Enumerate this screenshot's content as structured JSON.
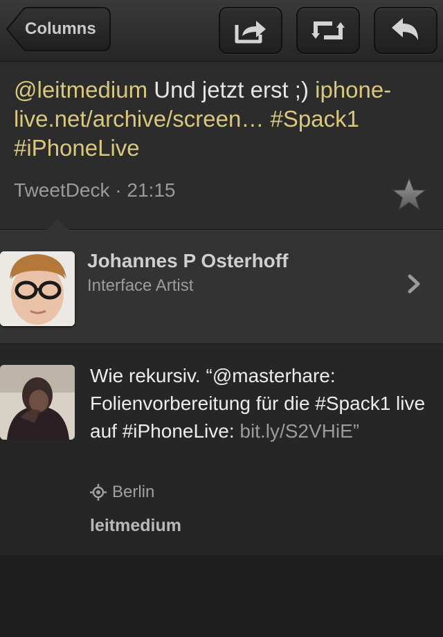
{
  "navbar": {
    "back_label": "Columns",
    "buttons": [
      {
        "name": "share-icon"
      },
      {
        "name": "retweet-icon"
      },
      {
        "name": "reply-icon"
      }
    ]
  },
  "tweet": {
    "mention": "@leitmedium",
    "text": " Und jetzt erst ;) ",
    "link": "iphone-live.net/archive/screen…",
    "hashtag1": " #Spack1",
    "hashtag2": "#iPhoneLive",
    "source": "TweetDeck",
    "separator": " · ",
    "time": "21:15",
    "star_icon": "star-icon"
  },
  "author": {
    "name": "Johannes P Osterhoff",
    "bio": "Interface Artist",
    "chevron_icon": "chevron-right-icon"
  },
  "reply": {
    "text": "Wie rekursiv. “@masterhare: Folienvorbereitung für die #Spack1 live auf #iPhoneLive: ",
    "link": "bit.ly/S2VHiE",
    "close_quote": "”",
    "location": "Berlin",
    "location_icon": "location-icon",
    "username": "leitmedium"
  },
  "colors": {
    "link": "#d9c77e",
    "background": "#1e1e1e",
    "text": "#e6e6e6"
  }
}
